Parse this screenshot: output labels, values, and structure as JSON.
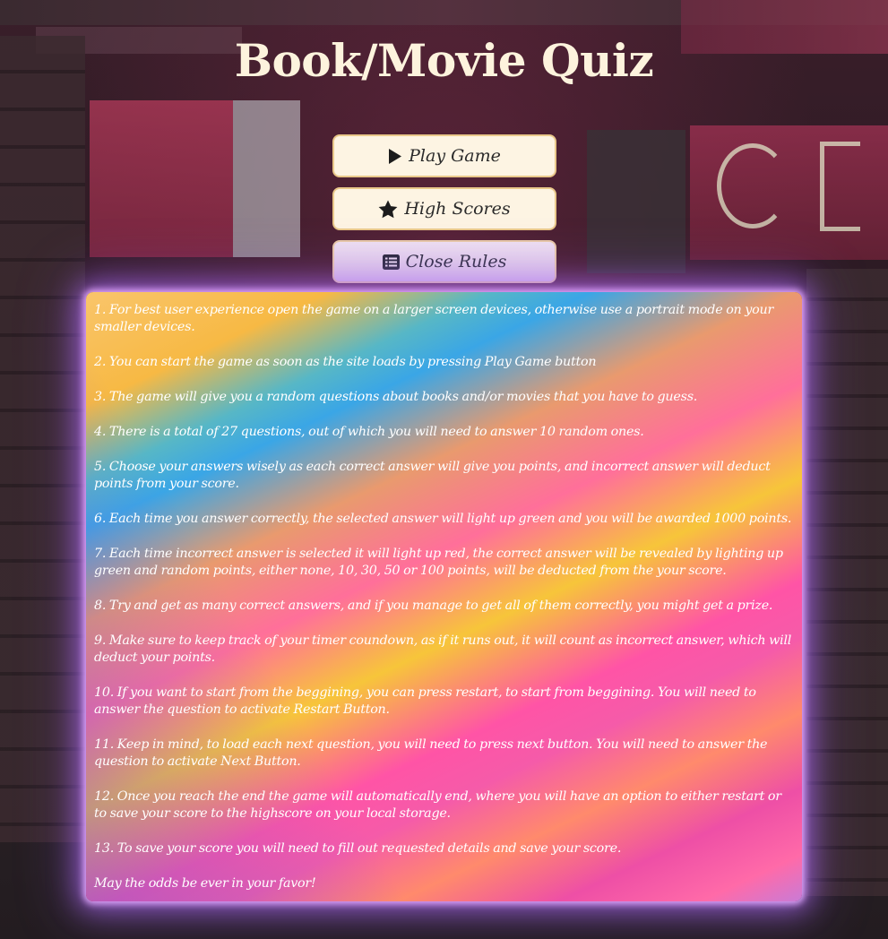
{
  "app": {
    "title": "Book/Movie Quiz"
  },
  "menu": {
    "play_label": "Play Game",
    "high_scores_label": "High Scores",
    "rules_label": "Close Rules"
  },
  "icons": {
    "play": "play-icon",
    "high_scores": "star-icon",
    "rules": "list-icon"
  },
  "rules": {
    "items": [
      "1. For best user experience open the game on a larger screen devices, otherwise use a portrait mode on your smaller devices.",
      "2. You can start the game as soon as the site loads by pressing Play Game button",
      "3. The game will give you a random questions about books and/or movies that you have to guess.",
      "4. There is a total of 27 questions, out of which you will need to answer 10 random ones.",
      "5. Choose your answers wisely as each correct answer will give you points, and incorrect answer will deduct points from your score.",
      "6. Each time you answer correctly, the selected answer will light up green and you will be awarded 1000 points.",
      "7. Each time incorrect answer is selected it will light up red, the correct answer will be revealed by lighting up green and random points, either none, 10, 30, 50 or 100 points, will be deducted from the your score.",
      "8. Try and get as many correct answers, and if you manage to get all of them correctly, you might get a prize.",
      "9. Make sure to keep track of your timer coundown, as if it runs out, it will count as incorrect answer, which will deduct your points.",
      "10. If you want to start from the beggining, you can press restart, to start from beggining. You will need to answer the question to activate Restart Button.",
      "11. Keep in mind, to load each next question, you will need to press next button. You will need to answer the question to activate Next Button.",
      "12. Once you reach the end the game will automatically end, where you will have an option to either restart or to save your score to the highscore on your local storage.",
      "13. To save your score you will need to fill out requested details and save your score.",
      "May the odds be ever in your favor!"
    ]
  },
  "colors": {
    "title": "#fdf3dd",
    "button_bg": "#fdf4e3",
    "button_border": "#e9c88a",
    "panel_glow": "#c58cff"
  }
}
